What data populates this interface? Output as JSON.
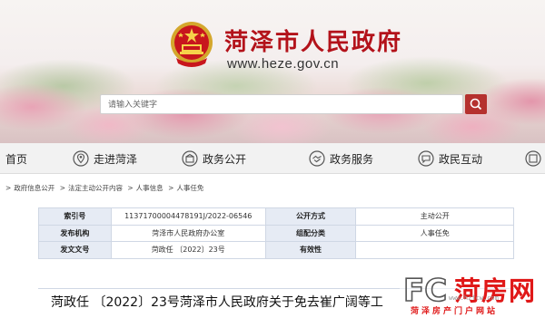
{
  "header": {
    "site_title": "菏泽市人民政府",
    "site_url": "www.heze.gov.cn",
    "search_placeholder": "请输入关键字"
  },
  "nav": {
    "items": [
      {
        "label": "首页",
        "icon": "home-icon"
      },
      {
        "label": "走进菏泽",
        "icon": "location-pin-icon"
      },
      {
        "label": "政务公开",
        "icon": "open-box-icon"
      },
      {
        "label": "政务服务",
        "icon": "handshake-icon"
      },
      {
        "label": "政民互动",
        "icon": "chat-bubble-icon"
      }
    ]
  },
  "breadcrumb": [
    "政府信息公开",
    "法定主动公开内容",
    "人事信息",
    "人事任免"
  ],
  "info_table": {
    "rows": [
      {
        "label1": "索引号",
        "value1": "11371700004478191J/2022-06546",
        "label2": "公开方式",
        "value2": "主动公开"
      },
      {
        "label1": "发布机构",
        "value1": "菏泽市人民政府办公室",
        "label2": "组配分类",
        "value2": "人事任免"
      },
      {
        "label1": "发文文号",
        "value1": "菏政任 〔2022〕23号",
        "label2": "有效性",
        "value2": ""
      }
    ]
  },
  "doc_title": "菏政任 〔2022〕23号菏泽市人民政府关于免去崔广阔等工",
  "watermark": {
    "logo_letters": "FC",
    "name": "菏房网",
    "sub": "菏泽房产门户网站",
    "small": "www.hzfcw.com"
  },
  "colors": {
    "brand_red": "#b3121a",
    "table_header_bg": "#e6ebf4",
    "watermark_red": "#e01818"
  }
}
